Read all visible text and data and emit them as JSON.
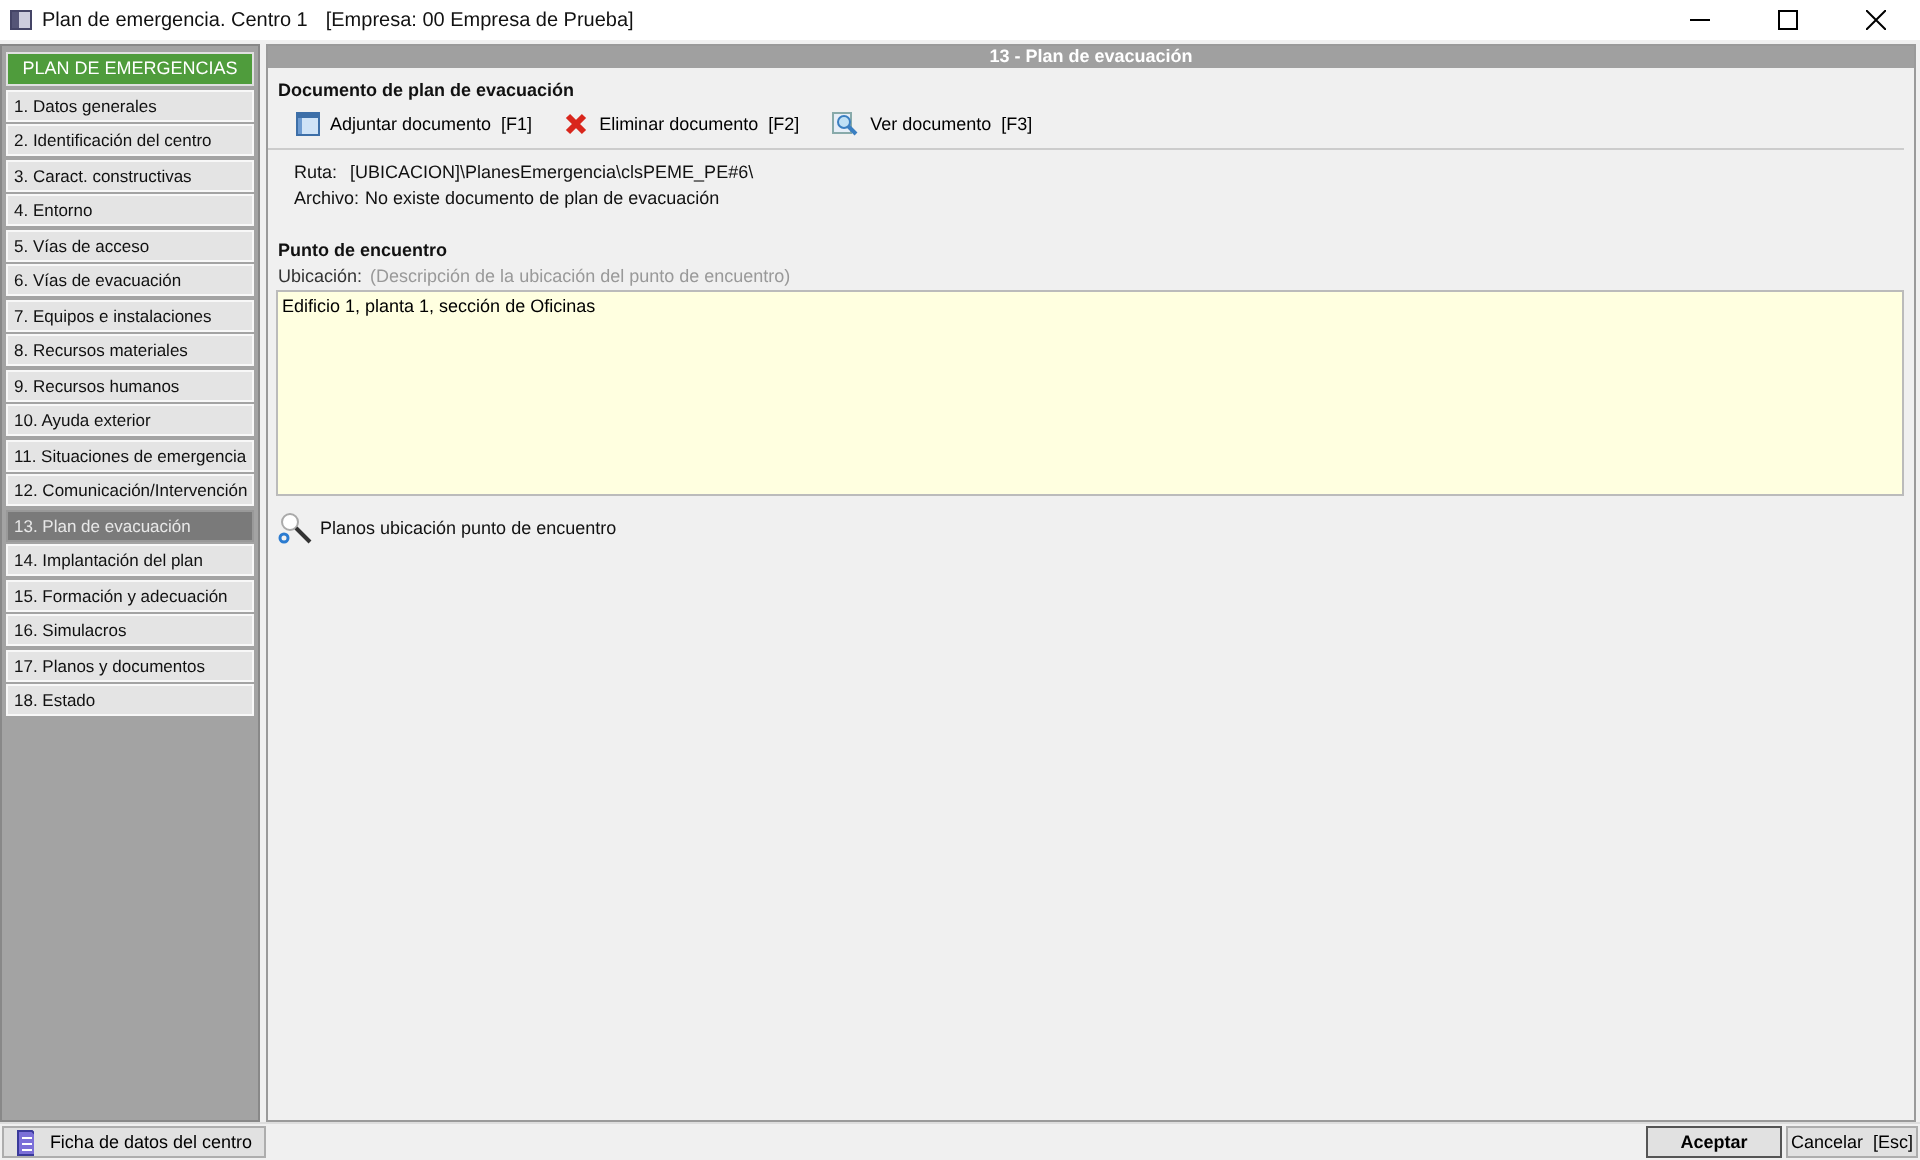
{
  "window": {
    "title": "Plan de emergencia. Centro 1",
    "subtitle": "[Empresa: 00 Empresa de Prueba]"
  },
  "sidebar": {
    "header": "PLAN DE EMERGENCIAS",
    "items": [
      {
        "label": "1. Datos generales",
        "selected": false
      },
      {
        "label": "2. Identificación del centro",
        "selected": false
      },
      {
        "label": "3. Caract. constructivas",
        "selected": false
      },
      {
        "label": "4. Entorno",
        "selected": false
      },
      {
        "label": "5. Vías de acceso",
        "selected": false
      },
      {
        "label": "6. Vías de evacuación",
        "selected": false
      },
      {
        "label": "7. Equipos e instalaciones",
        "selected": false
      },
      {
        "label": "8. Recursos materiales",
        "selected": false
      },
      {
        "label": "9. Recursos humanos",
        "selected": false
      },
      {
        "label": "10. Ayuda exterior",
        "selected": false
      },
      {
        "label": "11. Situaciones de emergencia",
        "selected": false
      },
      {
        "label": "12. Comunicación/Intervención",
        "selected": false
      },
      {
        "label": "13. Plan de evacuación",
        "selected": true
      },
      {
        "label": "14. Implantación del plan",
        "selected": false
      },
      {
        "label": "15. Formación y adecuación",
        "selected": false
      },
      {
        "label": "16. Simulacros",
        "selected": false
      },
      {
        "label": "17. Planos y documentos",
        "selected": false
      },
      {
        "label": "18. Estado",
        "selected": false
      }
    ]
  },
  "panel": {
    "title": "13 - Plan de evacuación",
    "document_section": {
      "heading": "Documento de plan de evacuación",
      "toolbar": [
        {
          "kind": "attach",
          "label": "Adjuntar documento  [F1]"
        },
        {
          "kind": "delete",
          "label": "Eliminar documento  [F2]"
        },
        {
          "kind": "view",
          "label": "Ver documento  [F3]"
        }
      ],
      "ruta_label": "Ruta:",
      "ruta_value": "[UBICACION]\\PlanesEmergencia\\clsPEME_PE#6\\",
      "archivo_label": "Archivo:",
      "archivo_value": "No existe documento de plan de evacuación"
    },
    "meeting_section": {
      "heading": "Punto de encuentro",
      "field_label": "Ubicación:",
      "field_hint": "(Descripción de la ubicación del punto de encuentro)",
      "value": "Edificio 1, planta 1, sección de Oficinas"
    },
    "maps_link": "Planos ubicación punto de encuentro"
  },
  "footer": {
    "left_button": "Ficha de datos del centro",
    "buttons": [
      "Aceptar",
      "Cancelar  [Esc]"
    ]
  }
}
